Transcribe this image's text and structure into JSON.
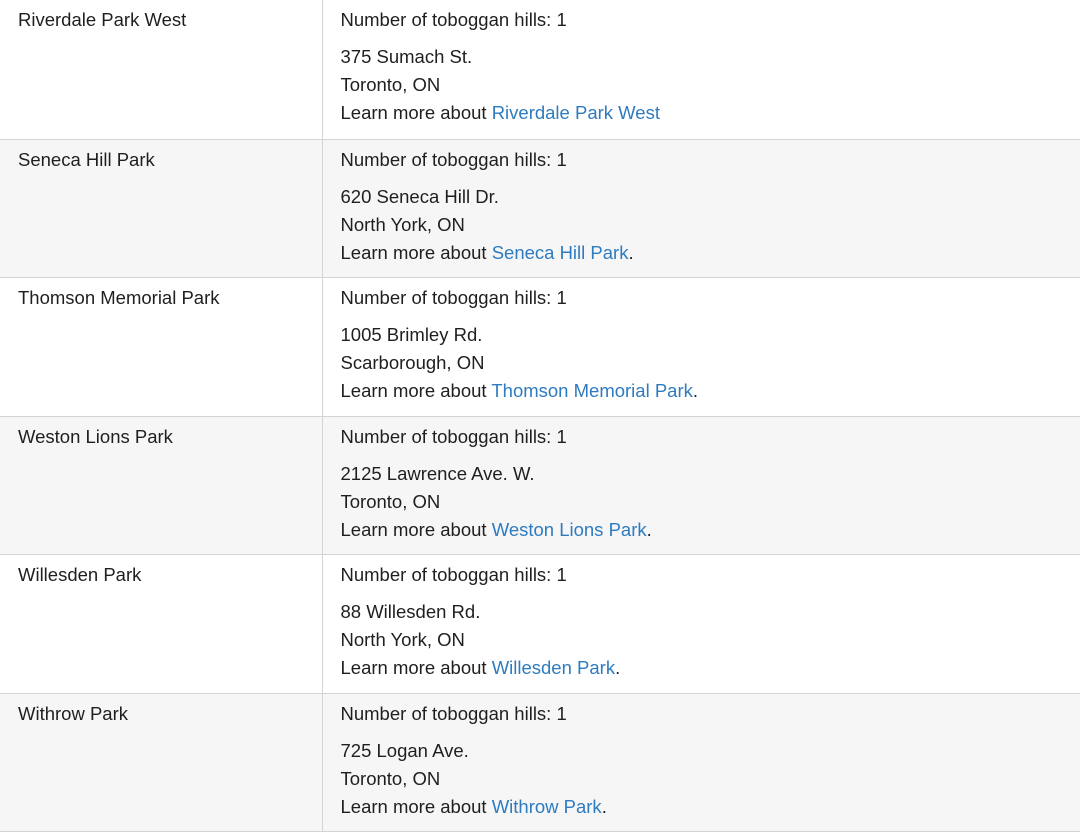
{
  "parks": [
    {
      "name": "Riverdale Park West",
      "hills": "Number of toboggan hills: 1",
      "street": "375 Sumach St.",
      "city": "Toronto, ON",
      "learn_prefix": "Learn more about ",
      "link_text": "Riverdale Park West",
      "suffix": ""
    },
    {
      "name": "Seneca Hill Park",
      "hills": "Number of toboggan hills: 1",
      "street": "620 Seneca Hill Dr.",
      "city": "North York, ON",
      "learn_prefix": "Learn more about ",
      "link_text": "Seneca Hill Park",
      "suffix": "."
    },
    {
      "name": "Thomson Memorial Park",
      "hills": "Number of toboggan hills: 1",
      "street": "1005 Brimley Rd.",
      "city": "Scarborough, ON",
      "learn_prefix": "Learn more about ",
      "link_text": "Thomson Memorial Park",
      "suffix": "."
    },
    {
      "name": "Weston Lions Park",
      "hills": "Number of toboggan hills: 1",
      "street": "2125 Lawrence Ave. W.",
      "city": "Toronto, ON",
      "learn_prefix": "Learn more about ",
      "link_text": "Weston Lions Park",
      "suffix": "."
    },
    {
      "name": "Willesden Park",
      "hills": "Number of toboggan hills: 1",
      "street": "88 Willesden Rd.",
      "city": "North York, ON",
      "learn_prefix": "Learn more about ",
      "link_text": "Willesden Park",
      "suffix": "."
    },
    {
      "name": "Withrow Park",
      "hills": "Number of toboggan hills: 1",
      "street": "725 Logan Ave.",
      "city": "Toronto, ON",
      "learn_prefix": "Learn more about ",
      "link_text": "Withrow Park",
      "suffix": "."
    }
  ],
  "colors": {
    "link": "#2e7bbf",
    "row_alt": "#f6f6f6",
    "border": "#d4d4d4"
  }
}
